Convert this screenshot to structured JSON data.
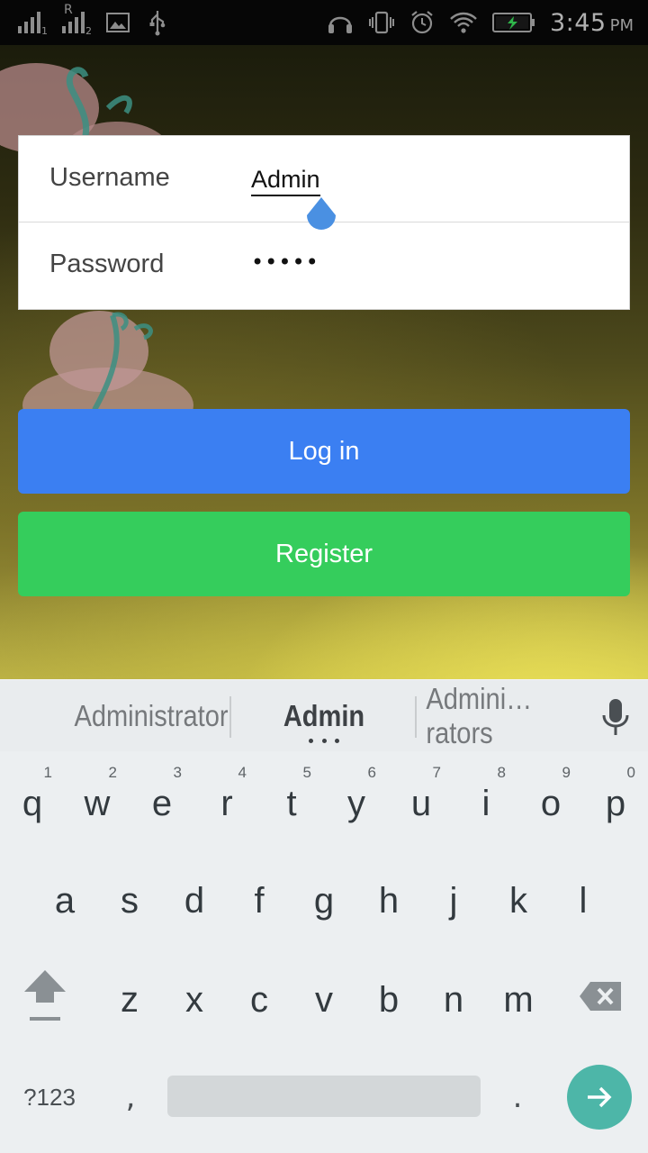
{
  "status_bar": {
    "sim1_sub": "1",
    "sim2_roaming": "R",
    "sim2_sub": "2",
    "time": "3:45",
    "ampm": "PM",
    "icons": [
      "signal-icon",
      "roaming-signal-icon",
      "image-icon",
      "usb-icon",
      "headset-icon",
      "vibrate-icon",
      "alarm-icon",
      "wifi-icon",
      "battery-charging-icon"
    ]
  },
  "login": {
    "username_label": "Username",
    "username_value": "Admin",
    "password_label": "Password",
    "password_value": "•••••"
  },
  "buttons": {
    "login_label": "Log in",
    "register_label": "Register",
    "login_color": "#3b7ff2",
    "register_color": "#35cd5c"
  },
  "suggestions": {
    "items": [
      "Administrator",
      "Admin",
      "Admini…rators"
    ]
  },
  "keyboard": {
    "row1": [
      {
        "key": "q",
        "hint": "1"
      },
      {
        "key": "w",
        "hint": "2"
      },
      {
        "key": "e",
        "hint": "3"
      },
      {
        "key": "r",
        "hint": "4"
      },
      {
        "key": "t",
        "hint": "5"
      },
      {
        "key": "y",
        "hint": "6"
      },
      {
        "key": "u",
        "hint": "7"
      },
      {
        "key": "i",
        "hint": "8"
      },
      {
        "key": "o",
        "hint": "9"
      },
      {
        "key": "p",
        "hint": "0"
      }
    ],
    "row2": [
      "a",
      "s",
      "d",
      "f",
      "g",
      "h",
      "j",
      "k",
      "l"
    ],
    "row3": [
      "z",
      "x",
      "c",
      "v",
      "b",
      "n",
      "m"
    ],
    "symbols_label": "?123",
    "comma": ",",
    "period": ".",
    "enter_color": "#4db6a8"
  }
}
